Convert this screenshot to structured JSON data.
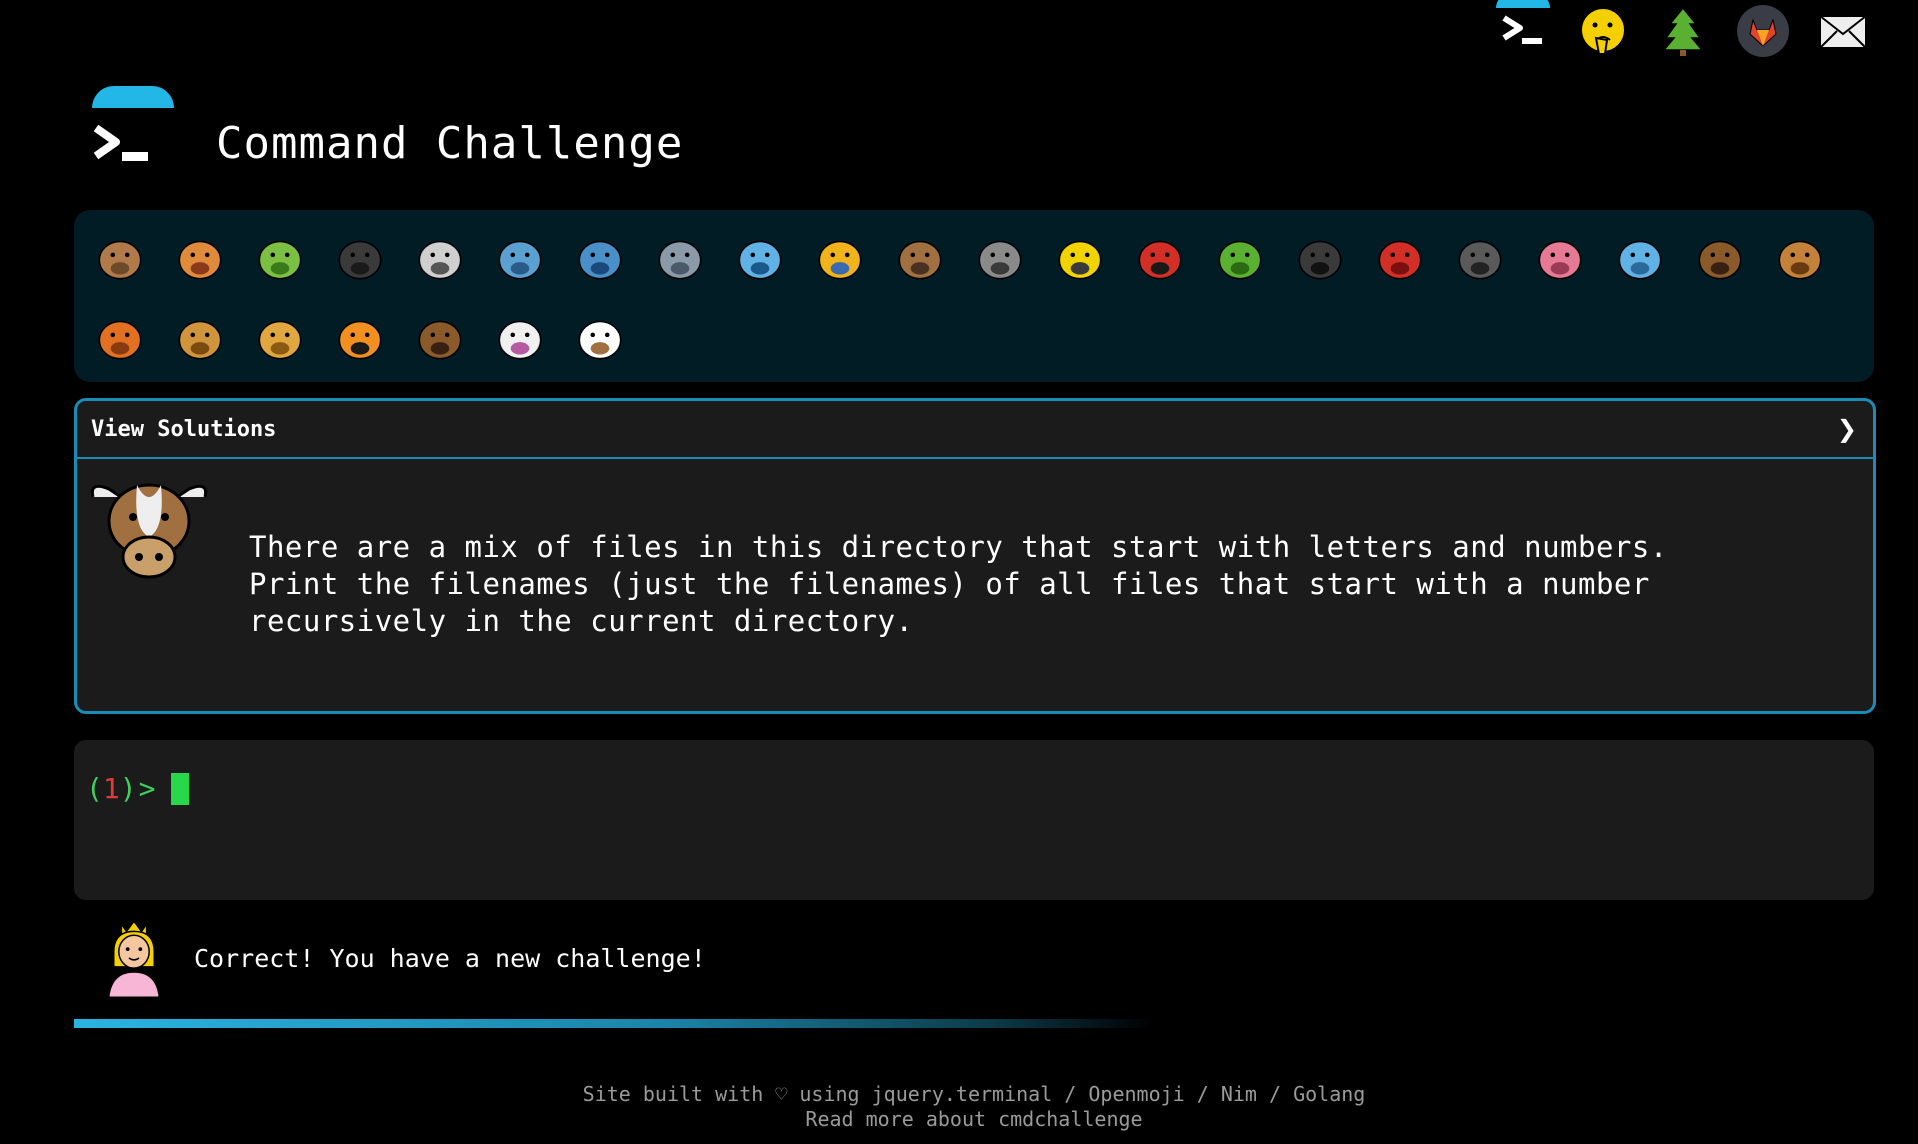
{
  "header": {
    "title": "Command Challenge"
  },
  "topnav": [
    {
      "name": "terminal-nav-icon"
    },
    {
      "name": "shush-face-nav-icon"
    },
    {
      "name": "tree-nav-icon"
    },
    {
      "name": "gitlab-nav-icon"
    },
    {
      "name": "mail-nav-icon"
    }
  ],
  "challenges": [
    "snail",
    "butterfly",
    "caterpillar",
    "ant",
    "spider-web",
    "whale",
    "dolphin",
    "shark",
    "fish",
    "tropical-fish",
    "blowfish",
    "wolf",
    "bee",
    "ladybug",
    "cricket",
    "spider",
    "scorpion",
    "fly",
    "worm",
    "microbe",
    "monkey",
    "dog",
    "fox",
    "cat",
    "lion",
    "tiger",
    "horse",
    "unicorn",
    "cow"
  ],
  "panel": {
    "header_label": "View Solutions",
    "chevron": "❯",
    "description": "There are a mix of files in this directory that start with letters and numbers.\nPrint the filenames (just the filenames) of all files that start with a number\nrecursively in the current directory."
  },
  "terminal": {
    "open_paren": "(",
    "number": "1",
    "close_paren": ")",
    "arrow": ">"
  },
  "status": {
    "message": "Correct! You have a new challenge!"
  },
  "progress": 0.6,
  "footer": {
    "line1": "Site built with ♡ using jquery.terminal / Openmoji / Nim / Golang",
    "line2": "Read more about cmdchallenge"
  },
  "colors": {
    "accent": "#22b7e6",
    "panel_border": "#1a8cb5",
    "strip_bg": "#011c24",
    "cursor": "#27d94a"
  }
}
